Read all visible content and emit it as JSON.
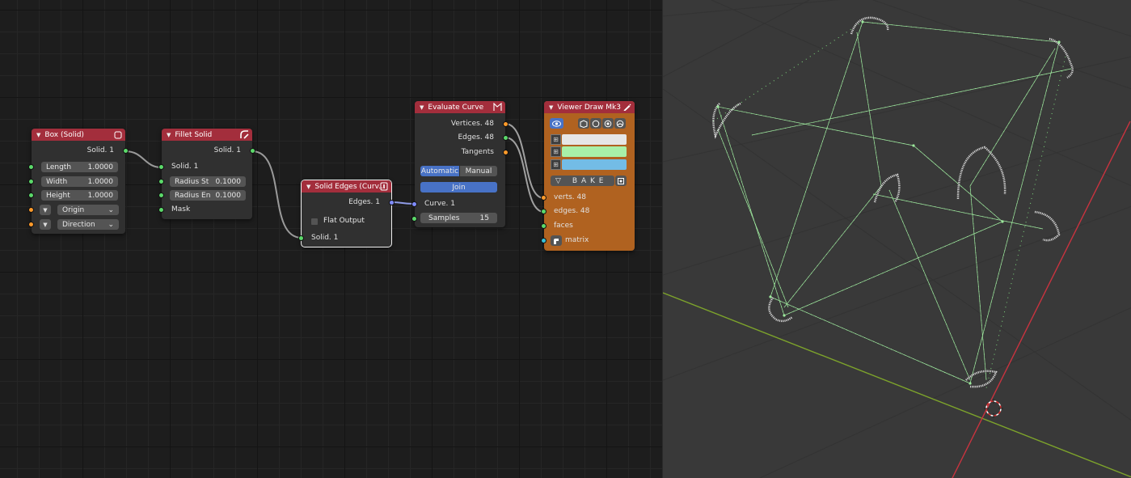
{
  "nodes": {
    "box": {
      "title": "Box (Solid)",
      "output": "Solid. 1",
      "length": {
        "label": "Length",
        "value": "1.0000"
      },
      "width": {
        "label": "Width",
        "value": "1.0000"
      },
      "height": {
        "label": "Height",
        "value": "1.0000"
      },
      "origin": "Origin",
      "direction": "Direction"
    },
    "fillet": {
      "title": "Fillet Solid",
      "output": "Solid. 1",
      "input_solid": "Solid. 1",
      "radius_start": {
        "label": "Radius St",
        "value": "0.1000"
      },
      "radius_end": {
        "label": "Radius En",
        "value": "0.1000"
      },
      "mask": "Mask"
    },
    "solid_edges": {
      "title": "Solid Edges (Curv...",
      "output": "Edges. 1",
      "flat_output": "Flat Output",
      "input_solid": "Solid. 1"
    },
    "evaluate": {
      "title": "Evaluate Curve",
      "vertices": "Vertices. 48",
      "edges": "Edges. 48",
      "tangents": "Tangents",
      "mode_automatic": "Automatic",
      "mode_manual": "Manual",
      "join": "Join",
      "curve_input": "Curve. 1",
      "samples": {
        "label": "Samples",
        "value": "15"
      }
    },
    "viewer": {
      "title": "Viewer Draw Mk3",
      "bake": "B A K E",
      "verts": "verts. 48",
      "edges": "edges. 48",
      "faces": "faces",
      "matrix": "matrix",
      "colors": {
        "vertex": "#e6e6e6",
        "edge": "#a8f0a8",
        "face": "#73bce6"
      }
    }
  },
  "theme": {
    "header_red": "#a32e3c",
    "viewer_orange": "#b06220",
    "socket_solid": "#5bd96a",
    "socket_vector": "#ff9a2a",
    "socket_curve": "#7f8cff",
    "wire_color": "#b7ec9e"
  }
}
